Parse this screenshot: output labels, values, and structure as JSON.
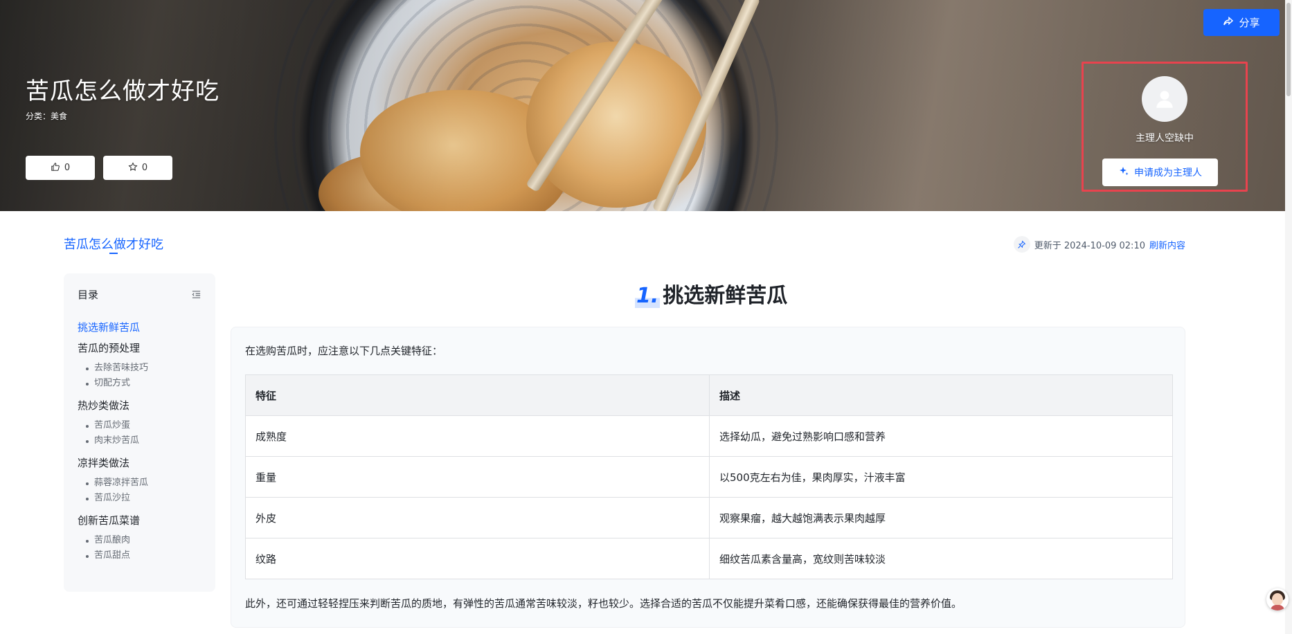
{
  "hero": {
    "title": "苦瓜怎么做才好吃",
    "category": "分类：美食",
    "like_count": "0",
    "favorite_count": "0",
    "share_label": "分享",
    "host_status": "主理人空缺中",
    "apply_label": "申请成为主理人"
  },
  "page": {
    "tab_label": "苦瓜怎么做才好吃",
    "updated_prefix": "更新于 2024-10-09 02:10",
    "refresh_label": "刷新内容"
  },
  "toc": {
    "title": "目录",
    "items": [
      {
        "label": "挑选新鲜苦瓜",
        "active": true,
        "children": []
      },
      {
        "label": "苦瓜的预处理",
        "children": [
          "去除苦味技巧",
          "切配方式"
        ]
      },
      {
        "label": "热炒类做法",
        "children": [
          "苦瓜炒蛋",
          "肉末炒苦瓜"
        ]
      },
      {
        "label": "凉拌类做法",
        "children": [
          "蒜蓉凉拌苦瓜",
          "苦瓜沙拉"
        ]
      },
      {
        "label": "创新苦瓜菜谱",
        "children": [
          "苦瓜酿肉",
          "苦瓜甜点"
        ]
      }
    ]
  },
  "section": {
    "number": "1.",
    "title": "挑选新鲜苦瓜",
    "intro": "在选购苦瓜时，应注意以下几点关键特征：",
    "table": {
      "headers": [
        "特征",
        "描述"
      ],
      "rows": [
        [
          "成熟度",
          "选择幼瓜，避免过熟影响口感和营养"
        ],
        [
          "重量",
          "以500克左右为佳，果肉厚实，汁液丰富"
        ],
        [
          "外皮",
          "观察果瘤，越大越饱满表示果肉越厚"
        ],
        [
          "纹路",
          "细纹苦瓜素含量高，宽纹则苦味较淡"
        ]
      ]
    },
    "outro": "此外，还可通过轻轻捏压来判断苦瓜的质地，有弹性的苦瓜通常苦味较淡，籽也较少。选择合适的苦瓜不仅能提升菜肴口感，还能确保获得最佳的营养价值。"
  },
  "icons": {
    "like": "thumbs-up-icon",
    "favorite": "star-icon",
    "share": "share-arrow-icon",
    "avatar": "user-avatar-icon",
    "apply": "sparkle-icon",
    "pin": "pin-icon",
    "collapse": "collapse-menu-icon"
  },
  "colors": {
    "accent": "#1664ff",
    "highlight_border": "#e8434e"
  }
}
